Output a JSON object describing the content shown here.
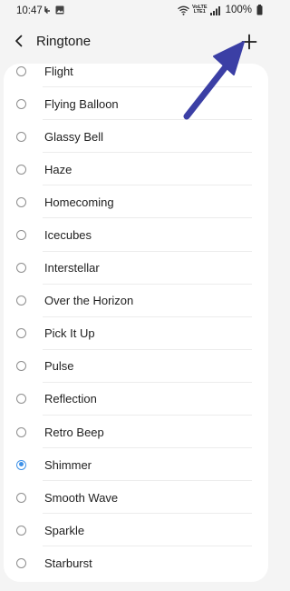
{
  "status_bar": {
    "time": "10:47",
    "battery": "100%",
    "network_label_top": "VoLTE",
    "network_label_bottom": "LTE1"
  },
  "header": {
    "title": "Ringtone",
    "back_icon": "back-arrow-icon",
    "add_icon": "plus-icon"
  },
  "ringtones": [
    {
      "label": "Flight",
      "checked": false
    },
    {
      "label": "Flying Balloon",
      "checked": false
    },
    {
      "label": "Glassy Bell",
      "checked": false
    },
    {
      "label": "Haze",
      "checked": false
    },
    {
      "label": "Homecoming",
      "checked": false
    },
    {
      "label": "Icecubes",
      "checked": false
    },
    {
      "label": "Interstellar",
      "checked": false
    },
    {
      "label": "Over the Horizon",
      "checked": false
    },
    {
      "label": "Pick It Up",
      "checked": false
    },
    {
      "label": "Pulse",
      "checked": false
    },
    {
      "label": "Reflection",
      "checked": false
    },
    {
      "label": "Retro Beep",
      "checked": false
    },
    {
      "label": "Shimmer",
      "checked": true
    },
    {
      "label": "Smooth Wave",
      "checked": false
    },
    {
      "label": "Sparkle",
      "checked": false
    },
    {
      "label": "Starburst",
      "checked": false
    }
  ],
  "colors": {
    "accent": "#3e91e8",
    "annotation_arrow": "#3b3fa5",
    "background": "#f4f4f4",
    "card": "#ffffff"
  }
}
